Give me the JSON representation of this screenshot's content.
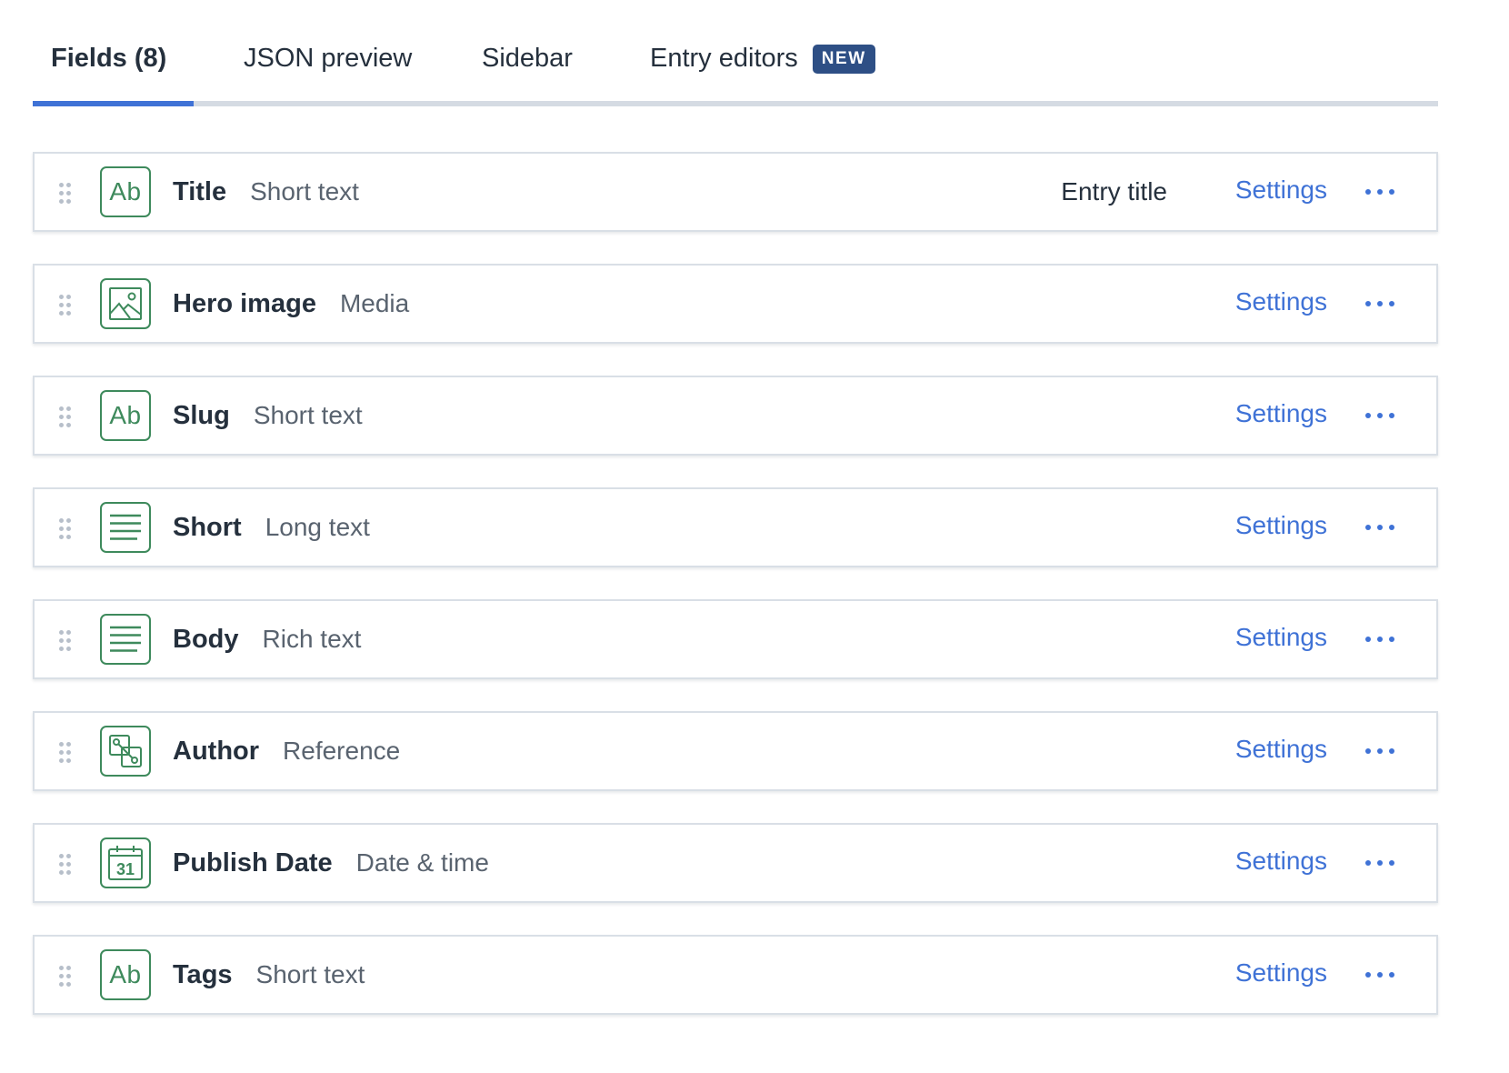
{
  "tabs": {
    "fields": "Fields (8)",
    "json_preview": "JSON preview",
    "sidebar": "Sidebar",
    "entry_editors": "Entry editors",
    "new_badge": "NEW"
  },
  "colors": {
    "accent": "#3f72d6",
    "icon_green": "#3e8a5c",
    "badge_bg": "#2e4f85"
  },
  "fields": [
    {
      "name": "Title",
      "type": "Short text",
      "icon": "short-text-icon",
      "entry_title_label": "Entry title",
      "settings": "Settings"
    },
    {
      "name": "Hero image",
      "type": "Media",
      "icon": "media-icon",
      "settings": "Settings"
    },
    {
      "name": "Slug",
      "type": "Short text",
      "icon": "short-text-icon",
      "settings": "Settings"
    },
    {
      "name": "Short",
      "type": "Long text",
      "icon": "long-text-icon",
      "settings": "Settings"
    },
    {
      "name": "Body",
      "type": "Rich text",
      "icon": "rich-text-icon",
      "settings": "Settings"
    },
    {
      "name": "Author",
      "type": "Reference",
      "icon": "reference-icon",
      "settings": "Settings"
    },
    {
      "name": "Publish Date",
      "type": "Date & time",
      "icon": "calendar-icon",
      "icon_text": "31",
      "settings": "Settings"
    },
    {
      "name": "Tags",
      "type": "Short text",
      "icon": "short-text-icon",
      "icon_text": "Ab",
      "settings": "Settings"
    }
  ],
  "icon_labels": {
    "short_text": "Ab"
  }
}
